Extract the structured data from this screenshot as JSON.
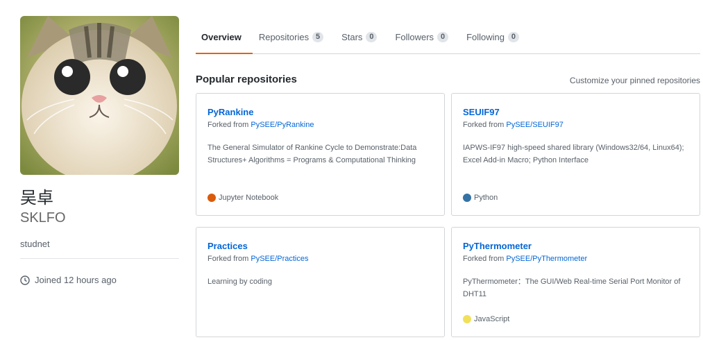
{
  "profile": {
    "full_name": "吴卓",
    "username": "SKLFO",
    "bio": "studnet",
    "joined": "Joined 12 hours ago"
  },
  "tabs": [
    {
      "label": "Overview"
    },
    {
      "label": "Repositories",
      "count": "5"
    },
    {
      "label": "Stars",
      "count": "0"
    },
    {
      "label": "Followers",
      "count": "0"
    },
    {
      "label": "Following",
      "count": "0"
    }
  ],
  "pinned": {
    "title": "Popular repositories",
    "customize_link": "Customize your pinned repositories",
    "repos": [
      {
        "name": "PyRankine",
        "fork_prefix": "Forked from ",
        "fork_source": "PySEE/PyRankine",
        "description": "The General Simulator of Rankine Cycle to Demonstrate:Data Structures+ Algorithms = Programs & Computational Thinking",
        "language": "Jupyter Notebook",
        "language_color": "#DA5B0B"
      },
      {
        "name": "SEUIF97",
        "fork_prefix": "Forked from ",
        "fork_source": "PySEE/SEUIF97",
        "description": "IAPWS-IF97 high-speed shared library (Windows32/64, Linux64); Excel Add-in Macro; Python Interface",
        "language": "Python",
        "language_color": "#3572A5"
      },
      {
        "name": "Practices",
        "fork_prefix": "Forked from ",
        "fork_source": "PySEE/Practices",
        "description": "Learning by coding",
        "language": "",
        "language_color": ""
      },
      {
        "name": "PyThermometer",
        "fork_prefix": "Forked from ",
        "fork_source": "PySEE/PyThermometer",
        "description": "PyThermometer：The GUI/Web Real-time Serial Port Monitor of DHT11",
        "language": "JavaScript",
        "language_color": "#F1E05A"
      }
    ]
  },
  "icons": {
    "joined": "clock-icon"
  }
}
